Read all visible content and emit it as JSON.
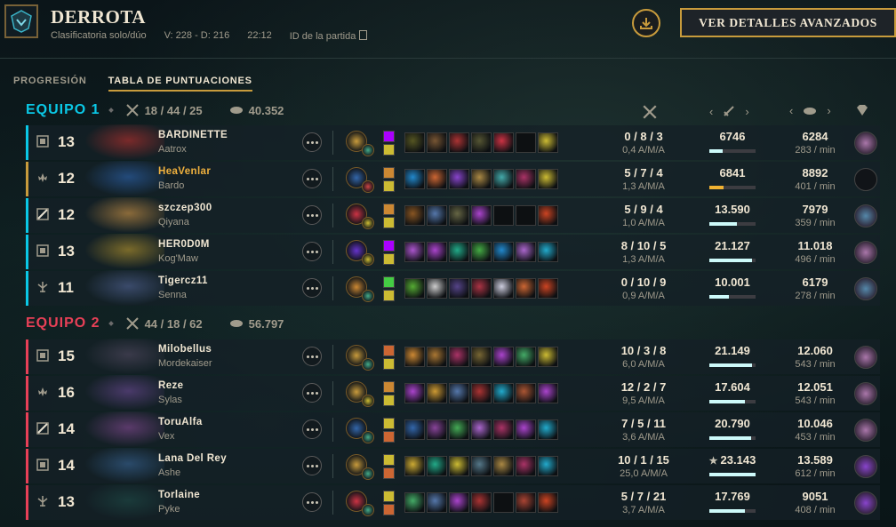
{
  "header": {
    "result": "DERROTA",
    "queue": "Clasificatoria solo/dúo",
    "record": "V: 228 - D: 216",
    "duration": "22:12",
    "match_id_label": "ID de la partida",
    "advanced_btn": "VER DETALLES AVANZADOS"
  },
  "tabs": [
    "PROGRESIÓN",
    "TABLA DE PUNTUACIONES"
  ],
  "team1": {
    "name": "EQUIPO 1",
    "kda": "18 / 44 / 25",
    "gold": "40.352",
    "color": "#0ac8e6"
  },
  "team2": {
    "name": "EQUIPO 2",
    "kda": "44 / 18 / 62",
    "gold": "56.797",
    "color": "#e84057"
  },
  "columns": {
    "kda_icon": "swords-icon",
    "damage_icon": "sword-icon",
    "gold_icon": "gold-icon",
    "trinket_icon": "ward-icon"
  },
  "players": [
    {
      "team": 1,
      "role": "top",
      "level": "13",
      "name": "BARDINETTE",
      "champion": "Aatrox",
      "kda": "0 / 8 / 3",
      "kda_ratio": "0,4 A/M/A",
      "damage": "6746",
      "dmg_frac": 0.29,
      "gold": "6284",
      "gpm": "283 / min",
      "me": false,
      "hue": "#7a2a2a",
      "rune": "#c89b3c",
      "rune2": "#4a8",
      "spells": [
        "#a0f",
        "#cb3"
      ],
      "items": [
        "#552",
        "#753",
        "#a33",
        "#553",
        "#c34",
        "#111",
        "#cb3"
      ],
      "trinket": "#a7a"
    },
    {
      "team": 1,
      "role": "support",
      "level": "12",
      "name": "HeaVenlar",
      "champion": "Bardo",
      "kda": "5 / 7 / 4",
      "kda_ratio": "1,3 A/M/A",
      "damage": "6841",
      "dmg_frac": 0.3,
      "gold": "8892",
      "gpm": "401 / min",
      "me": true,
      "hue": "#234a7a",
      "rune": "#36a",
      "rune2": "#c44",
      "spells": [
        "#c83",
        "#cb3"
      ],
      "items": [
        "#28c",
        "#c63",
        "#84c",
        "#a84",
        "#4aa",
        "#a36",
        "#cb3"
      ],
      "trinket": "#111"
    },
    {
      "team": 1,
      "role": "mid",
      "level": "12",
      "name": "szczep300",
      "champion": "Qiyana",
      "kda": "5 / 9 / 4",
      "kda_ratio": "1,0 A/M/A",
      "damage": "13.590",
      "dmg_frac": 0.59,
      "gold": "7979",
      "gpm": "359 / min",
      "me": false,
      "hue": "#8a6a3a",
      "rune": "#c34",
      "rune2": "#cb3",
      "spells": [
        "#c83",
        "#cb3"
      ],
      "items": [
        "#852",
        "#57a",
        "#664",
        "#a4c",
        "#111",
        "#111",
        "#c42"
      ],
      "trinket": "#58a"
    },
    {
      "team": 1,
      "role": "top",
      "level": "13",
      "name": "HER0D0M",
      "champion": "Kog'Maw",
      "kda": "8 / 10 / 5",
      "kda_ratio": "1,3 A/M/A",
      "damage": "21.127",
      "dmg_frac": 0.92,
      "gold": "11.018",
      "gpm": "496 / min",
      "me": false,
      "hue": "#7a6a2a",
      "rune": "#63c",
      "rune2": "#cb3",
      "spells": [
        "#a0f",
        "#cb3"
      ],
      "items": [
        "#a5c",
        "#a4c",
        "#2a8",
        "#4a4",
        "#28c",
        "#a6c",
        "#2ac"
      ],
      "trinket": "#a7a"
    },
    {
      "team": 1,
      "role": "bottom",
      "level": "11",
      "name": "Tigercz11",
      "champion": "Senna",
      "kda": "0 / 10 / 9",
      "kda_ratio": "0,9 A/M/A",
      "damage": "10.001",
      "dmg_frac": 0.43,
      "gold": "6179",
      "gpm": "278 / min",
      "me": false,
      "hue": "#3a4a6a",
      "rune": "#c83",
      "rune2": "#4a8",
      "spells": [
        "#4c4",
        "#cb3"
      ],
      "items": [
        "#5a3",
        "#ccc",
        "#548",
        "#a34",
        "#ccd",
        "#c63",
        "#c42"
      ],
      "trinket": "#58a"
    },
    {
      "team": 2,
      "role": "top",
      "level": "15",
      "name": "Milobellus",
      "champion": "Mordekaiser",
      "kda": "10 / 3 / 8",
      "kda_ratio": "6,0 A/M/A",
      "damage": "21.149",
      "dmg_frac": 0.92,
      "gold": "12.060",
      "gpm": "543 / min",
      "me": false,
      "hue": "#3a3a4a",
      "rune": "#c89b3c",
      "rune2": "#4a8",
      "spells": [
        "#c63",
        "#cb3"
      ],
      "items": [
        "#c83",
        "#a73",
        "#a36",
        "#763",
        "#a4c",
        "#4a6",
        "#cb3"
      ],
      "trinket": "#a7a"
    },
    {
      "team": 2,
      "role": "support",
      "level": "16",
      "name": "Reze",
      "champion": "Sylas",
      "kda": "12 / 2 / 7",
      "kda_ratio": "9,5 A/M/A",
      "damage": "17.604",
      "dmg_frac": 0.76,
      "gold": "12.051",
      "gpm": "543 / min",
      "me": false,
      "hue": "#4a3a6a",
      "rune": "#c89b3c",
      "rune2": "#cb3",
      "spells": [
        "#c83",
        "#cb3"
      ],
      "items": [
        "#a4c",
        "#c93",
        "#57a",
        "#a33",
        "#2ac",
        "#a53",
        "#a4c"
      ],
      "trinket": "#a7a"
    },
    {
      "team": 2,
      "role": "mid",
      "level": "14",
      "name": "ToruAlfa",
      "champion": "Vex",
      "kda": "7 / 5 / 11",
      "kda_ratio": "3,6 A/M/A",
      "damage": "20.790",
      "dmg_frac": 0.9,
      "gold": "10.046",
      "gpm": "453 / min",
      "me": false,
      "hue": "#5a3a6a",
      "rune": "#36a",
      "rune2": "#4a8",
      "spells": [
        "#cb3",
        "#c63"
      ],
      "items": [
        "#36a",
        "#849",
        "#4a5",
        "#a6c",
        "#a36",
        "#a4c",
        "#2ac"
      ],
      "trinket": "#a7a"
    },
    {
      "team": 2,
      "role": "top",
      "level": "14",
      "name": "Lana Del Rey",
      "champion": "Ashe",
      "kda": "10 / 1 / 15",
      "kda_ratio": "25,0 A/M/A",
      "damage": "23.143",
      "dmg_frac": 1.0,
      "gold": "13.589",
      "gpm": "612 / min",
      "me": false,
      "hue": "#2a4a6a",
      "rune": "#c89b3c",
      "rune2": "#4a8",
      "spells": [
        "#cb3",
        "#c63"
      ],
      "items": [
        "#ca3",
        "#2a8",
        "#cb3",
        "#578",
        "#a84",
        "#a36",
        "#2ac"
      ],
      "trinket": "#84c",
      "star": "★"
    },
    {
      "team": 2,
      "role": "bottom",
      "level": "13",
      "name": "Torlaine",
      "champion": "Pyke",
      "kda": "5 / 7 / 21",
      "kda_ratio": "3,7 A/M/A",
      "damage": "17.769",
      "dmg_frac": 0.77,
      "gold": "9051",
      "gpm": "408 / min",
      "me": false,
      "hue": "#1a3a3a",
      "rune": "#c34",
      "rune2": "#4a8",
      "spells": [
        "#cb3",
        "#c63"
      ],
      "items": [
        "#4a6",
        "#57a",
        "#a4c",
        "#a33",
        "#111",
        "#a43",
        "#c42"
      ],
      "trinket": "#84c"
    }
  ]
}
